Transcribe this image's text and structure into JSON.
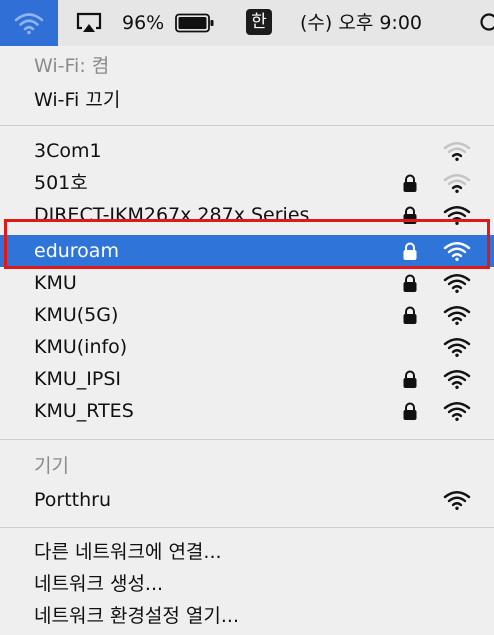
{
  "menubar": {
    "wifi_icon": "wifi-icon",
    "airplay_icon": "airplay-icon",
    "battery_percent": "96%",
    "battery_icon": "battery-icon",
    "input_method": "한",
    "clock": "(수) 오후 9:00",
    "search_icon": "search-icon"
  },
  "wifi_status": {
    "status_label": "Wi-Fi: 켬",
    "toggle_label": "Wi-Fi 끄기"
  },
  "networks": [
    {
      "name": "3Com1",
      "locked": false,
      "signal": "weak"
    },
    {
      "name": "501호",
      "locked": true,
      "signal": "weak"
    },
    {
      "name": "DIRECT-IKM267x 287x Series",
      "locked": true,
      "signal": "full"
    },
    {
      "name": "eduroam",
      "locked": true,
      "signal": "full",
      "selected": true
    },
    {
      "name": "KMU",
      "locked": true,
      "signal": "full"
    },
    {
      "name": "KMU(5G)",
      "locked": true,
      "signal": "full"
    },
    {
      "name": "KMU(info)",
      "locked": false,
      "signal": "full"
    },
    {
      "name": "KMU_IPSI",
      "locked": true,
      "signal": "full"
    },
    {
      "name": "KMU_RTES",
      "locked": true,
      "signal": "full"
    }
  ],
  "devices": {
    "header": "기기",
    "items": [
      {
        "name": "Portthru",
        "signal": "full"
      }
    ]
  },
  "actions": [
    {
      "label": "다른 네트워크에 연결..."
    },
    {
      "label": "네트워크 생성..."
    },
    {
      "label": "네트워크 환경설정 열기..."
    }
  ],
  "colors": {
    "selection": "#2f74d8",
    "menubar_active": "#2f6fd6",
    "annotation_box": "#e01818",
    "menu_bg": "#efefef",
    "menubar_bg": "#e6e6e6"
  }
}
